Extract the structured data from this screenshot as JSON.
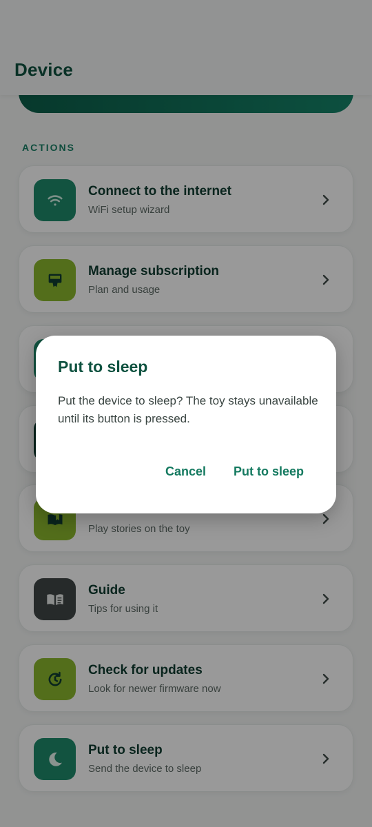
{
  "header": {
    "title": "Device"
  },
  "section": {
    "label": "ACTIONS"
  },
  "actions": [
    {
      "title": "Connect to the internet",
      "subtitle": "WiFi setup wizard",
      "icon": "wifi-icon",
      "color": "#1f8a6c"
    },
    {
      "title": "Manage subscription",
      "subtitle": "Plan and usage",
      "icon": "subscription-icon",
      "color": "#8ab82e"
    },
    {
      "title": "",
      "subtitle": "",
      "icon": "app-icon",
      "color": "#1f8a6c"
    },
    {
      "title": "",
      "subtitle": "",
      "icon": "app-icon",
      "color": "#0f3d31"
    },
    {
      "title": "",
      "subtitle": "Play stories on the toy",
      "icon": "book-icon",
      "color": "#8ab82e"
    },
    {
      "title": "Guide",
      "subtitle": "Tips for using it",
      "icon": "guide-icon",
      "color": "#404746"
    },
    {
      "title": "Check for updates",
      "subtitle": "Look for newer firmware now",
      "icon": "update-icon",
      "color": "#8ab82e"
    },
    {
      "title": "Put to sleep",
      "subtitle": "Send the device to sleep",
      "icon": "moon-icon",
      "color": "#1f8a6c"
    }
  ],
  "dialog": {
    "title": "Put to sleep",
    "body": "Put the device to sleep? The toy stays unavailable until its button is pressed.",
    "cancel_label": "Cancel",
    "confirm_label": "Put to sleep"
  }
}
